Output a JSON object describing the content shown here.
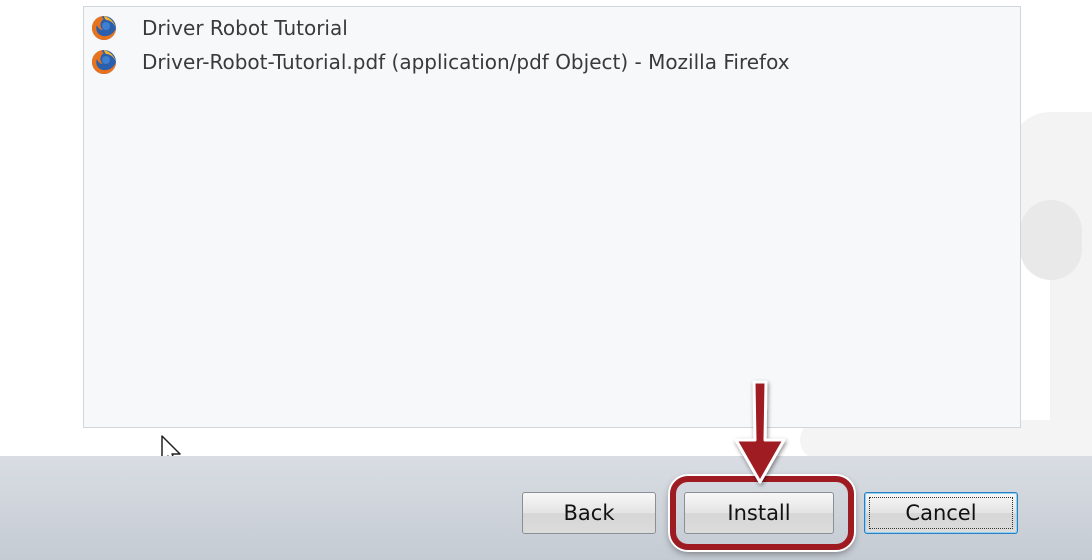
{
  "list": {
    "items": [
      {
        "label": "Driver Robot Tutorial",
        "icon": "firefox-icon"
      },
      {
        "label": "Driver-Robot-Tutorial.pdf (application/pdf Object) - Mozilla Firefox",
        "icon": "firefox-icon"
      }
    ]
  },
  "buttons": {
    "back_label": "Back",
    "install_label": "Install",
    "cancel_label": "Cancel"
  },
  "colors": {
    "highlight": "#9e1b22",
    "focus_border": "#2a7fc0"
  }
}
